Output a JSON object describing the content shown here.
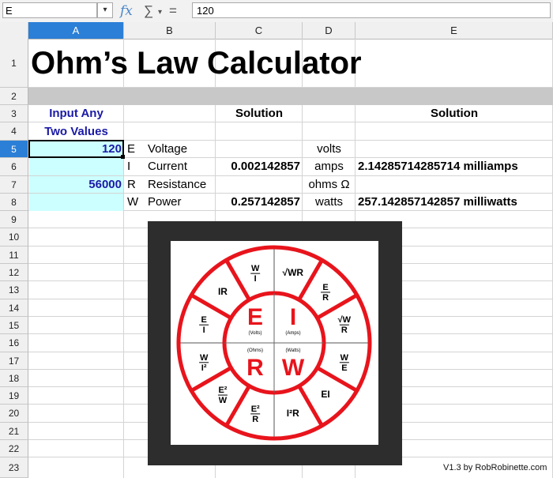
{
  "formula_bar": {
    "name_box": "E",
    "formula": "120"
  },
  "columns": [
    "A",
    "B",
    "C",
    "D",
    "E"
  ],
  "rows": [
    "1",
    "2",
    "3",
    "4",
    "5",
    "6",
    "7",
    "8",
    "9",
    "10",
    "11",
    "12",
    "13",
    "14",
    "15",
    "16",
    "17",
    "18",
    "19",
    "20",
    "21",
    "22",
    "23"
  ],
  "sheet": {
    "title": "Ohm’s Law Calculator",
    "input_header_1": "Input Any",
    "input_header_2": "Two Values",
    "solution_header_c": "Solution",
    "solution_header_e": "Solution",
    "rows": [
      {
        "input": "120",
        "letter": "E",
        "name": "Voltage",
        "solution": "",
        "unit": "volts",
        "text_solution": ""
      },
      {
        "input": "",
        "letter": "I",
        "name": "Current",
        "solution": "0.002142857",
        "unit": "amps",
        "text_solution": "2.14285714285714 milliamps"
      },
      {
        "input": "56000",
        "letter": "R",
        "name": "Resistance",
        "solution": "",
        "unit": "ohms Ω",
        "text_solution": ""
      },
      {
        "input": "",
        "letter": "W",
        "name": "Power",
        "solution": "0.257142857",
        "unit": "watts",
        "text_solution": "257.142857142857 milliwatts"
      }
    ],
    "footer": "V1.3 by RobRobinette.com"
  },
  "wheel": {
    "center": {
      "E": "E",
      "I": "I",
      "R": "R",
      "W": "W",
      "volts": "(Volts)",
      "amps": "(Amps)",
      "ohms": "(Ohms)",
      "watts": "(Watts)"
    },
    "segments": [
      "√WR",
      "E/R",
      "√W/R",
      "W/E",
      "EI",
      "I²R",
      "E²/R",
      "E²/W",
      "W/I²",
      "E/I",
      "IR",
      "W/I"
    ],
    "ring_color": "#e8141c"
  },
  "colors": {
    "selection": "#2b7fd6",
    "input_fill": "#ccffff",
    "blue_text": "#1a1aa6"
  }
}
